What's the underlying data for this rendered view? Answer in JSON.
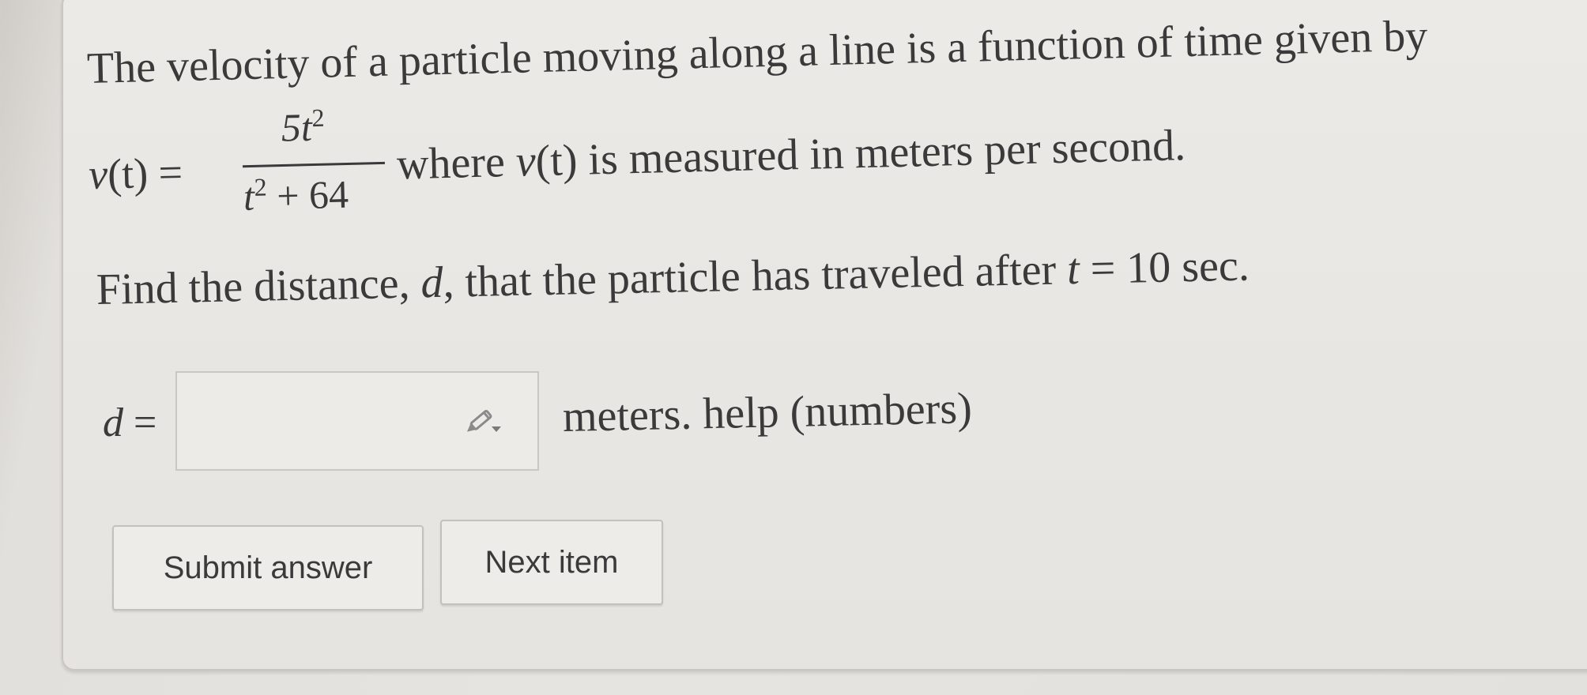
{
  "question": {
    "intro": "The velocity of a particle moving along a line is a function of time given by",
    "formula_lhs_v": "v",
    "formula_lhs_t": "(t) =",
    "numerator": "5t",
    "numerator_exp": "2",
    "denominator_var": "t",
    "denominator_exp": "2",
    "denominator_rest": " + 64",
    "formula_suffix_pre": "where ",
    "formula_suffix_v": "v",
    "formula_suffix_post": "(t) is measured in meters per second.",
    "find_pre": "Find the distance, ",
    "find_d": "d",
    "find_mid": ", that the particle has traveled after ",
    "find_t": "t",
    "find_post": " = 10 sec."
  },
  "answer": {
    "label_var": "d",
    "label_eq": " =",
    "input_value": "",
    "input_placeholder": "",
    "units": "meters.",
    "help_label": "help (numbers)",
    "edit_icon": "pencil-icon"
  },
  "buttons": {
    "submit_label": "Submit answer",
    "next_label": "Next item"
  }
}
